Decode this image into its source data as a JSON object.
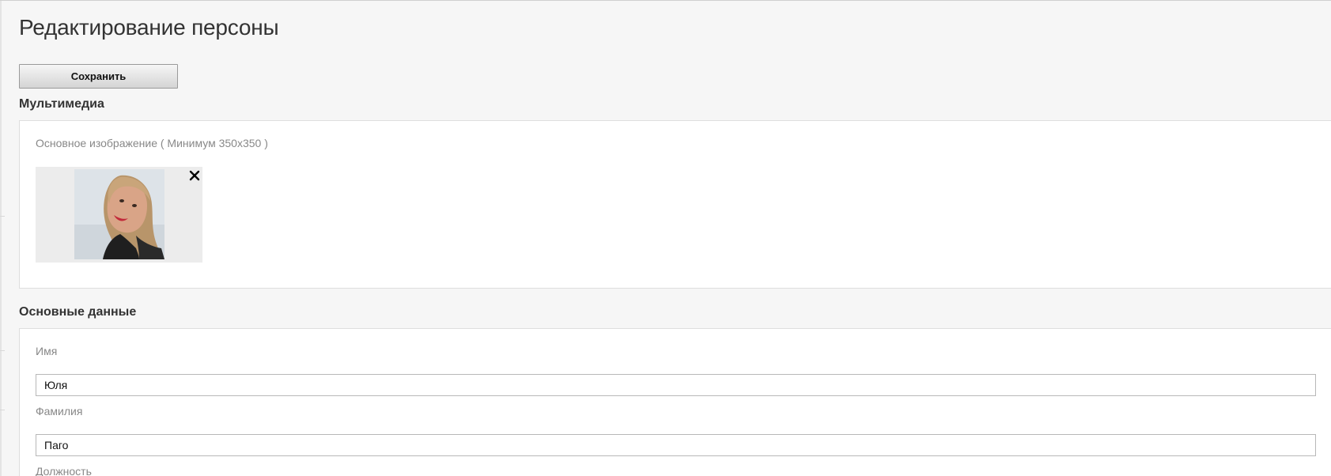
{
  "page": {
    "title": "Редактирование персоны"
  },
  "toolbar": {
    "save_label": "Сохранить"
  },
  "multimedia": {
    "section_title": "Мультимедиа",
    "main_image_label": "Основное изображение ( Минимум 350x350 )",
    "remove_icon": "close-icon"
  },
  "basic": {
    "section_title": "Основные данные",
    "first_name_label": "Имя",
    "first_name_value": "Юля",
    "last_name_label": "Фамилия",
    "last_name_value": "Паго",
    "position_label": "Должность"
  },
  "colors": {
    "page_background": "#f6f6f6",
    "panel_background": "#ffffff",
    "label_text": "#888888"
  }
}
